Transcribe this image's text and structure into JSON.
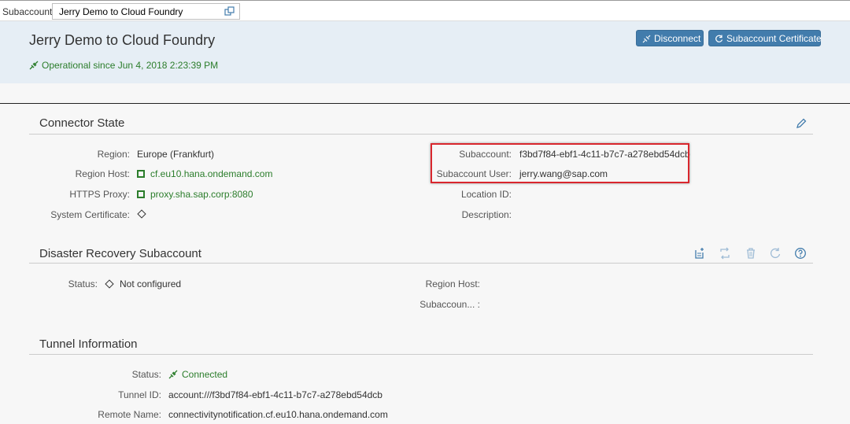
{
  "topbar": {
    "subaccount_label": "Subaccount:",
    "subaccount_value": "Jerry Demo to Cloud Foundry"
  },
  "header": {
    "title": "Jerry Demo to Cloud Foundry",
    "status": "Operational since Jun 4, 2018 2:23:39 PM",
    "disconnect_label": "Disconnect",
    "certificate_label": "Subaccount Certificate"
  },
  "connector_state": {
    "title": "Connector State",
    "left": [
      {
        "label": "Region:",
        "value": "Europe (Frankfurt)"
      },
      {
        "label": "Region Host:",
        "value": "cf.eu10.hana.ondemand.com"
      },
      {
        "label": "HTTPS Proxy:",
        "value": "proxy.sha.sap.corp:8080"
      },
      {
        "label": "System Certificate:",
        "value": ""
      }
    ],
    "right": [
      {
        "label": "Subaccount:",
        "value": "f3bd7f84-ebf1-4c11-b7c7-a278ebd54dcb"
      },
      {
        "label": "Subaccount User:",
        "value": "jerry.wang@sap.com"
      },
      {
        "label": "Location ID:",
        "value": ""
      },
      {
        "label": "Description:",
        "value": ""
      }
    ]
  },
  "disaster_recovery": {
    "title": "Disaster Recovery Subaccount",
    "status_label": "Status:",
    "status_value": "Not configured",
    "region_host_label": "Region Host:",
    "subaccount_label": "Subaccoun... :"
  },
  "tunnel": {
    "title": "Tunnel Information",
    "rows": [
      {
        "label": "Status:",
        "value": "Connected"
      },
      {
        "label": "Tunnel ID:",
        "value": "account:///f3bd7f84-ebf1-4c11-b7c7-a278ebd54dcb"
      },
      {
        "label": "Remote Name:",
        "value": "connectivitynotification.cf.eu10.hana.ondemand.com"
      }
    ]
  },
  "colors": {
    "accent": "#427cac",
    "success": "#2b7d2b",
    "highlight": "#d9262d",
    "header_bg": "#e6eef5"
  }
}
